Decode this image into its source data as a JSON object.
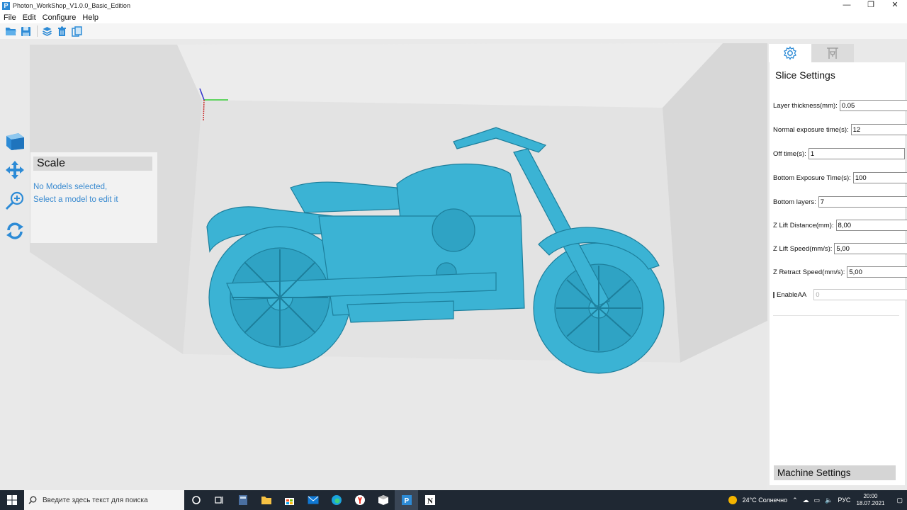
{
  "window": {
    "title": "Photon_WorkShop_V1.0.0_Basic_Edition",
    "app_icon_letter": "P",
    "minimize_glyph": "—",
    "restore_glyph": "❐",
    "close_glyph": "✕"
  },
  "menu": [
    "File",
    "Edit",
    "Configure",
    "Help"
  ],
  "scale_panel": {
    "title": "Scale",
    "message_line1": "No Models selected,",
    "message_line2": "Select a model to edit it"
  },
  "slice_settings": {
    "title": "Slice Settings",
    "layer_thickness": {
      "label": "Layer thickness(mm):",
      "value": "0.05"
    },
    "normal_exposure": {
      "label": "Normal exposure time(s):",
      "value": "12"
    },
    "off_time": {
      "label": "Off time(s):",
      "value": "1"
    },
    "bottom_exposure": {
      "label": "Bottom Exposure Time(s):",
      "value": "100"
    },
    "bottom_layers": {
      "label": "Bottom layers:",
      "value": "7"
    },
    "z_lift_distance": {
      "label": "Z Lift Distance(mm):",
      "value": "8,00"
    },
    "z_lift_speed": {
      "label": "Z Lift Speed(mm/s):",
      "value": "5,00"
    },
    "z_retract_speed": {
      "label": "Z Retract Speed(mm/s):",
      "value": "5,00"
    },
    "enable_aa": {
      "label": "EnableAA",
      "value": "0"
    },
    "machine_settings_label": "Machine Settings"
  },
  "taskbar": {
    "search_placeholder": "Введите здесь текст для поиска",
    "weather": "24°C  Солнечно",
    "language": "РУС",
    "time": "20:00",
    "date": "18.07.2021"
  },
  "colors": {
    "model": "#3bb3d4",
    "accent": "#2d8bd6"
  }
}
